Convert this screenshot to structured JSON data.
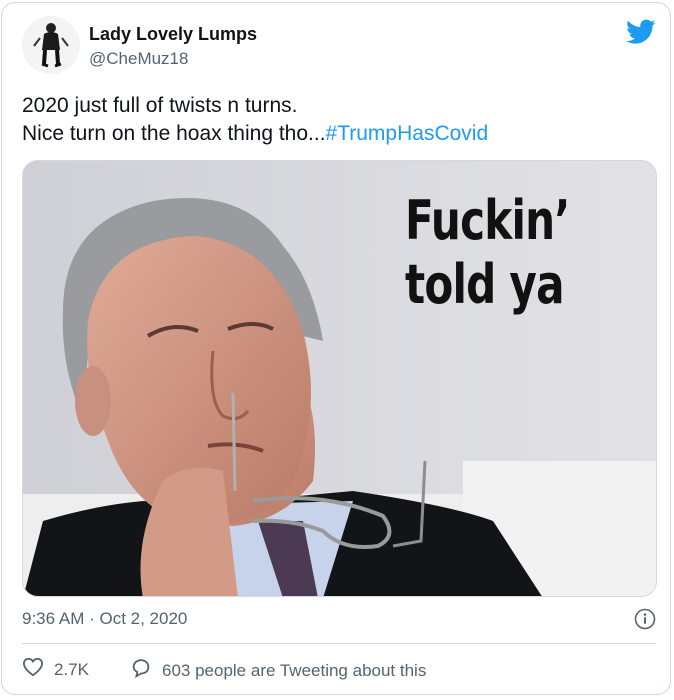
{
  "tweet": {
    "author_name": "Lady Lovely Lumps",
    "author_handle": "@CheMuz18",
    "text_line1": "2020 just full of twists n turns.",
    "text_line2_prefix": "Nice turn on the hoax thing tho...",
    "hashtag": "#TrumpHasCovid",
    "timestamp": "9:36 AM · Oct 2, 2020",
    "likes": "2.7K",
    "tweeting": "603 people are Tweeting about this"
  },
  "media": {
    "caption_line1": "Fuckin’",
    "caption_line2": "told ya"
  },
  "colors": {
    "accent": "#1d9bf0",
    "text_secondary": "#536471",
    "border": "#cfd9de"
  },
  "icons": {
    "brand": "twitter-bird-icon",
    "info": "info-icon",
    "like": "heart-icon",
    "reply": "speech-bubble-icon"
  }
}
